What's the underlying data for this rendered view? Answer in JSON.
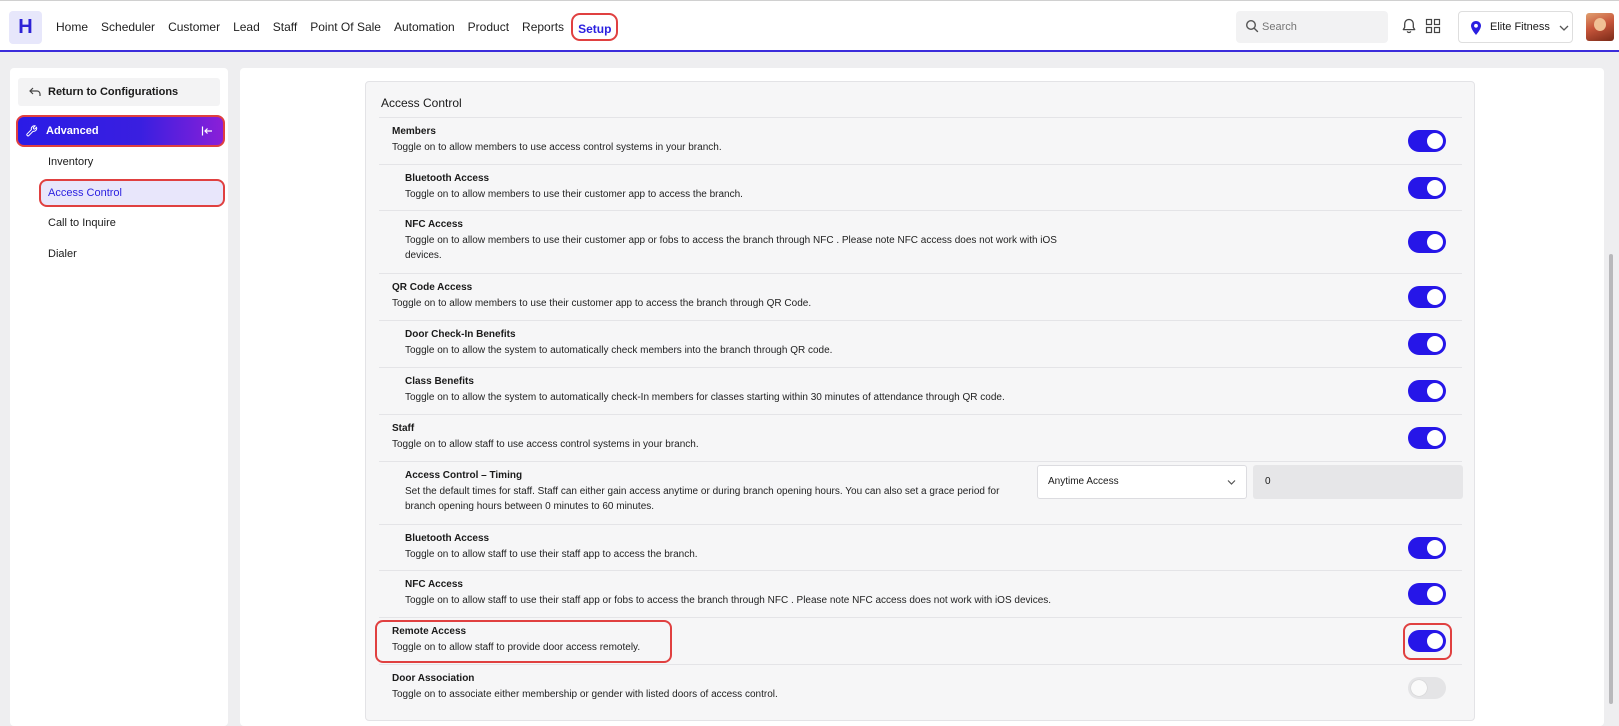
{
  "header": {
    "logo": "H",
    "nav": [
      "Home",
      "Scheduler",
      "Customer",
      "Lead",
      "Staff",
      "Point Of Sale",
      "Automation",
      "Product",
      "Reports",
      "Setup"
    ],
    "search_placeholder": "Search",
    "branch": "Elite Fitness",
    "accent": "#2a1fe0"
  },
  "sidebar": {
    "return_label": "Return to Configurations",
    "section": "Advanced",
    "items": [
      "Inventory",
      "Access Control",
      "Call to Inquire",
      "Dialer"
    ]
  },
  "main": {
    "title": "Access Control",
    "rows": [
      {
        "title": "Members",
        "desc": "Toggle on to allow members to use access control systems in your branch.",
        "on": true
      },
      {
        "title": "Bluetooth Access",
        "desc": "Toggle on to allow members to use their customer app to access the branch.",
        "on": true
      },
      {
        "title": "NFC Access",
        "desc": "Toggle on to allow members to use their customer app or fobs to access the branch through NFC . Please note NFC access does not work with iOS devices.",
        "on": true
      },
      {
        "title": "QR Code Access",
        "desc": "Toggle on to allow members to use their customer app to access the branch through QR Code.",
        "on": true
      },
      {
        "title": "Door Check-In Benefits",
        "desc": "Toggle on to allow the system to automatically check members into the branch through QR code.",
        "on": true
      },
      {
        "title": "Class Benefits",
        "desc": "Toggle on to allow the system to automatically check-In members for classes starting within 30 minutes of attendance through QR code.",
        "on": true
      },
      {
        "title": "Staff",
        "desc": "Toggle on to allow staff to use access control systems in your branch.",
        "on": true
      },
      {
        "title": "Access Control – Timing",
        "desc": "Set the default times for staff. Staff can either gain access anytime or during branch opening hours. You can also set a grace period for branch opening hours between 0 minutes to 60 minutes.",
        "select": "Anytime Access",
        "grace_value": "0"
      },
      {
        "title": "Bluetooth Access",
        "desc": "Toggle on to allow staff to use their staff app to access the branch.",
        "on": true
      },
      {
        "title": "NFC Access",
        "desc": "Toggle on to allow staff to use their staff app or fobs to access the branch through NFC . Please note NFC access does not work with iOS devices.",
        "on": true
      },
      {
        "title": "Remote Access",
        "desc": "Toggle on to allow staff to provide door access remotely.",
        "on": true
      },
      {
        "title": "Door Association",
        "desc": "Toggle on to associate either membership or gender with listed doors of access control.",
        "on": false
      }
    ]
  }
}
